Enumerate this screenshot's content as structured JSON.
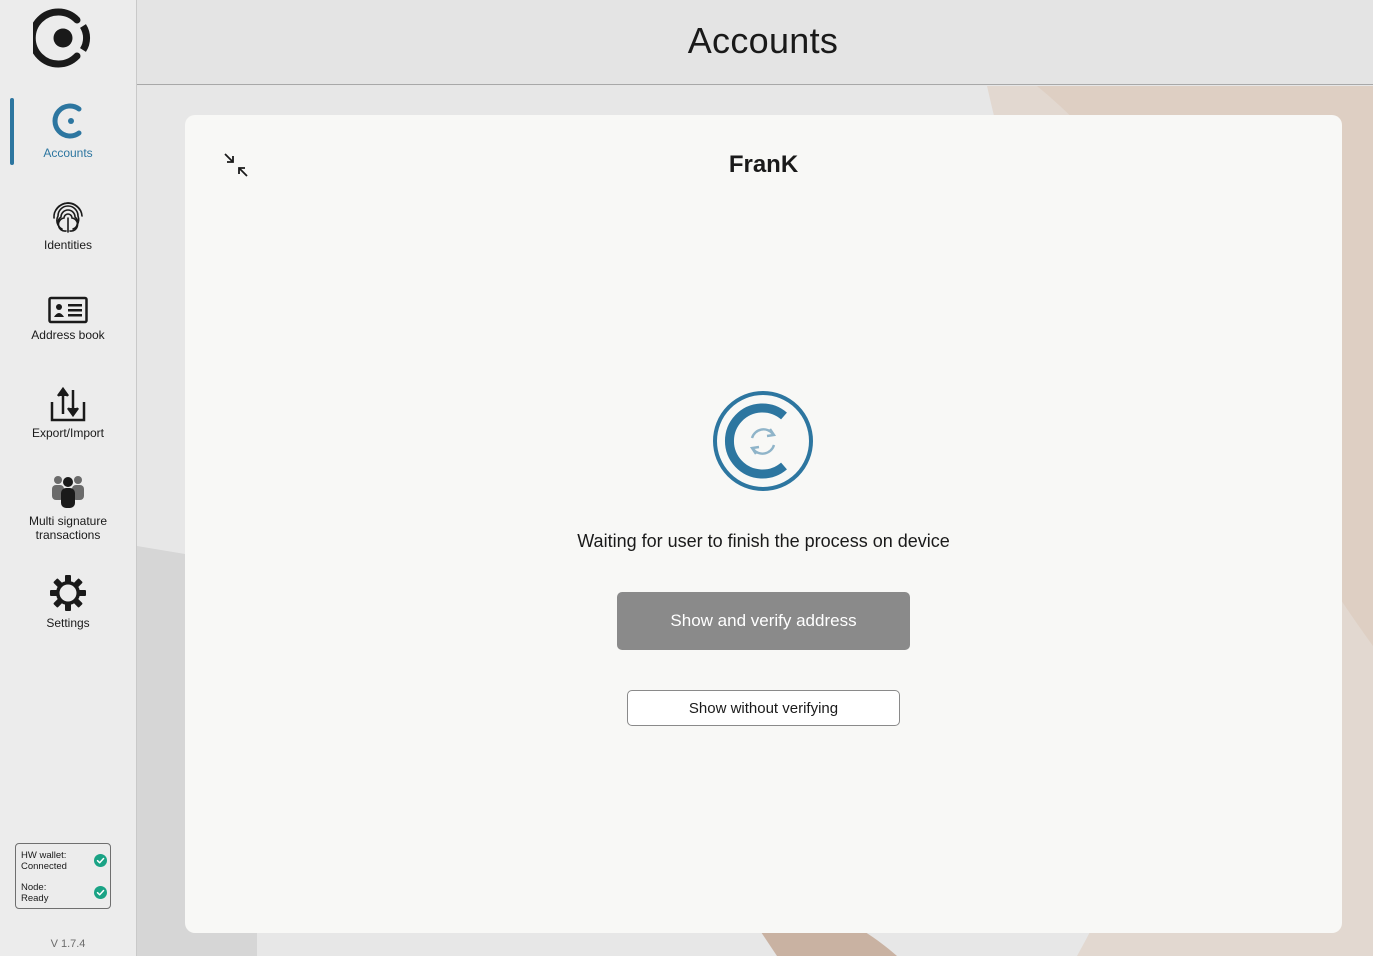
{
  "sidebar": {
    "items": [
      {
        "label": "Accounts",
        "icon": "accounts-icon"
      },
      {
        "label": "Identities",
        "icon": "fingerprint-icon"
      },
      {
        "label": "Address book",
        "icon": "address-book-icon"
      },
      {
        "label": "Export/Import",
        "icon": "export-import-icon"
      },
      {
        "label": "Multi signature\ntransactions",
        "icon": "multisig-icon"
      },
      {
        "label": "Settings",
        "icon": "gear-icon"
      }
    ],
    "status": {
      "hw_wallet_label": "HW wallet:",
      "hw_wallet_value": "Connected",
      "node_label": "Node:",
      "node_value": "Ready"
    },
    "version": "V 1.7.4"
  },
  "header": {
    "title": "Accounts"
  },
  "card": {
    "account_name": "FranK",
    "waiting_text": "Waiting for user to finish the process on device",
    "verify_button": "Show and verify address",
    "no_verify_button": "Show without verifying"
  },
  "colors": {
    "accent": "#2d76a0",
    "status_ok": "#1aa385",
    "primary_button": "#8a8a8a"
  }
}
